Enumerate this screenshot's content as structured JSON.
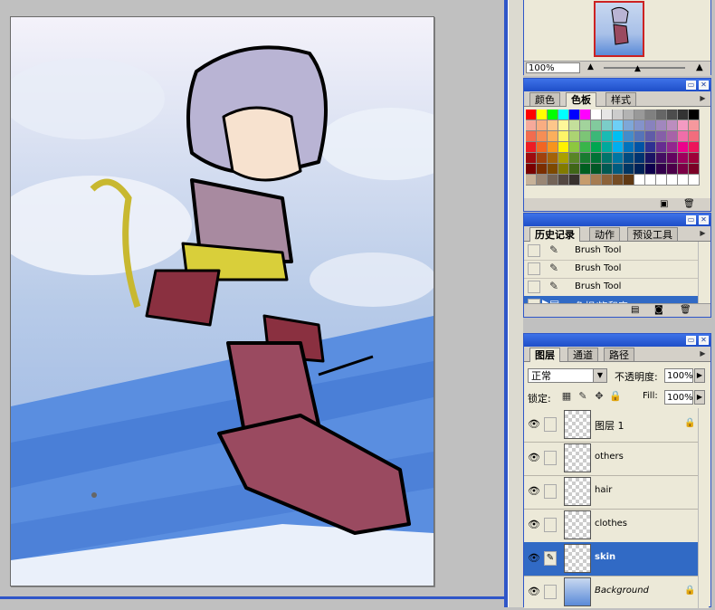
{
  "navigator": {
    "zoom": "100%"
  },
  "swatches": {
    "tabs": [
      {
        "label": "颜色"
      },
      {
        "label": "色板"
      },
      {
        "label": "样式"
      }
    ],
    "active_tab": 1,
    "colors": [
      "#ff0000",
      "#ffff00",
      "#00ff00",
      "#00ffff",
      "#0000ff",
      "#ff00ff",
      "#ffffff",
      "#e6e6e6",
      "#cccccc",
      "#b3b3b3",
      "#999999",
      "#808080",
      "#666666",
      "#4d4d4d",
      "#333333",
      "#000000",
      "#f6a99a",
      "#f9ad81",
      "#fdc68a",
      "#fff799",
      "#c4df9b",
      "#a2d39c",
      "#82ca9d",
      "#7bcdc8",
      "#6ecff6",
      "#7ea7d8",
      "#8493ca",
      "#8882be",
      "#a187be",
      "#bc8dbf",
      "#f49ac2",
      "#f6989d",
      "#f26c4f",
      "#f68e55",
      "#fbaf5c",
      "#fff467",
      "#acd372",
      "#7cc576",
      "#3bb878",
      "#1abbb4",
      "#00bff3",
      "#438ccb",
      "#5574b9",
      "#605ca8",
      "#855fa8",
      "#a763a8",
      "#f06ea9",
      "#f26d7d",
      "#ed1c24",
      "#f26522",
      "#f7941d",
      "#fff200",
      "#8dc73f",
      "#39b54a",
      "#00a651",
      "#00a99d",
      "#00aeef",
      "#0072bc",
      "#0054a6",
      "#2e3192",
      "#662d91",
      "#92278f",
      "#ec008c",
      "#ed145b",
      "#9e0b0f",
      "#a0410d",
      "#a36209",
      "#aba000",
      "#598527",
      "#197b30",
      "#007236",
      "#00746b",
      "#0076a3",
      "#004b80",
      "#003471",
      "#1b1464",
      "#440e62",
      "#630460",
      "#9e005d",
      "#9e0039",
      "#790000",
      "#7b2e00",
      "#7d4900",
      "#827b00",
      "#406618",
      "#005e20",
      "#005826",
      "#005952",
      "#005b7f",
      "#003663",
      "#002157",
      "#0d004c",
      "#32004b",
      "#4b0049",
      "#7b0046",
      "#7a0026",
      "#c7b299",
      "#998675",
      "#736357",
      "#534741",
      "#37302d",
      "#c69c6d",
      "#a67c52",
      "#8c6239",
      "#754c24",
      "#603913",
      "#ffffff",
      "#ffffff",
      "#ffffff",
      "#ffffff",
      "#ffffff",
      "#ffffff"
    ]
  },
  "history": {
    "tabs": [
      {
        "label": "历史记录"
      },
      {
        "label": "动作"
      },
      {
        "label": "预设工具"
      }
    ],
    "items": [
      {
        "label": "Brush Tool",
        "selected": false
      },
      {
        "label": "Brush Tool",
        "selected": false
      },
      {
        "label": "Brush Tool",
        "selected": false
      },
      {
        "label": "色相/饱和度",
        "selected": true
      }
    ]
  },
  "layers": {
    "tabs": [
      {
        "label": "图层"
      },
      {
        "label": "通道"
      },
      {
        "label": "路径"
      }
    ],
    "blend_mode": "正常",
    "opacity_label": "不透明度:",
    "opacity": "100%",
    "lock_label": "锁定:",
    "fill_label": "Fill:",
    "fill": "100%",
    "items": [
      {
        "name": "图层 1",
        "selected": false,
        "locked": true
      },
      {
        "name": "others",
        "selected": false,
        "locked": false
      },
      {
        "name": "hair",
        "selected": false,
        "locked": false
      },
      {
        "name": "clothes",
        "selected": false,
        "locked": false
      },
      {
        "name": "skin",
        "selected": true,
        "locked": false
      },
      {
        "name": "Background",
        "selected": false,
        "locked": true
      }
    ]
  }
}
